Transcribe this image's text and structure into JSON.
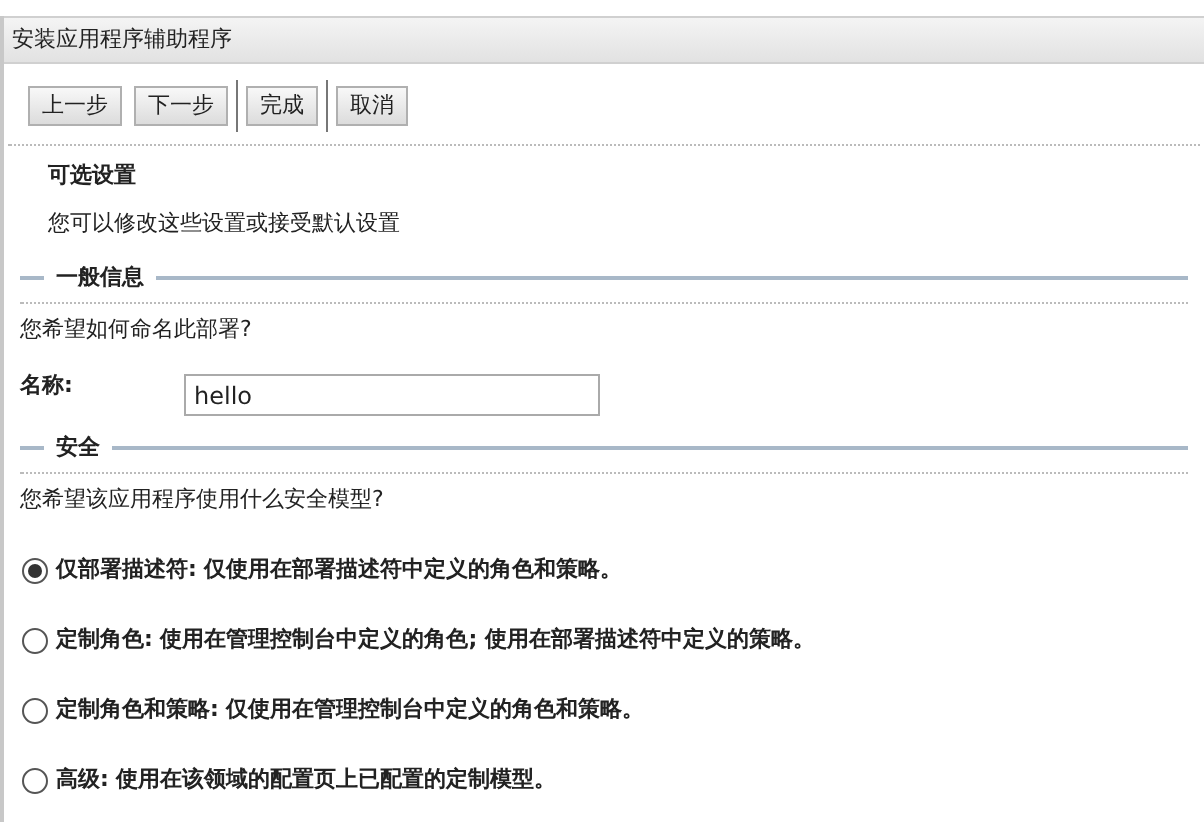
{
  "window": {
    "title": "安装应用程序辅助程序"
  },
  "button_groups": [
    [
      "上一步",
      "下一步"
    ],
    [
      "完成"
    ],
    [
      "取消"
    ]
  ],
  "heading": "可选设置",
  "intro": "您可以修改这些设置或接受默认设置",
  "sections": [
    {
      "title": "一般信息",
      "question": "您希望如何命名此部署?",
      "field": {
        "label": "名称:",
        "value": "hello"
      }
    },
    {
      "title": "安全",
      "question": "您希望该应用程序使用什么安全模型?",
      "options": [
        {
          "label": "仅部署描述符: 仅使用在部署描述符中定义的角色和策略。",
          "selected": true
        },
        {
          "label": "定制角色: 使用在管理控制台中定义的角色; 使用在部署描述符中定义的策略。",
          "selected": false
        },
        {
          "label": "定制角色和策略: 仅使用在管理控制台中定义的角色和策略。",
          "selected": false
        },
        {
          "label": "高级: 使用在该领域的配置页上已配置的定制模型。",
          "selected": false
        }
      ]
    }
  ]
}
